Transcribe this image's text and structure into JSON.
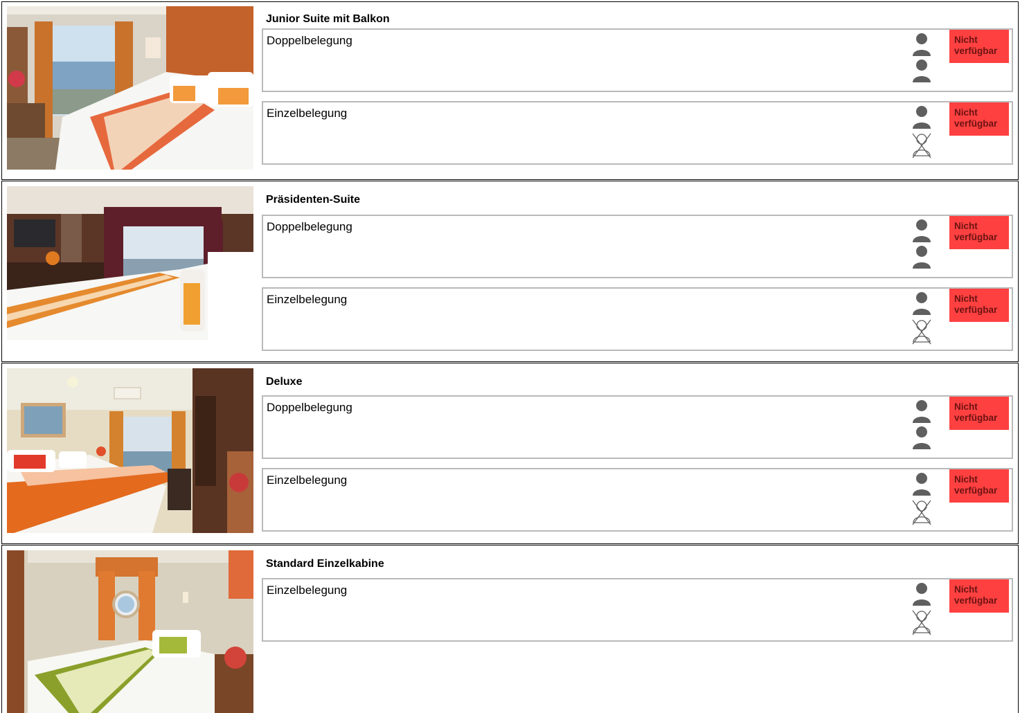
{
  "cabins": [
    {
      "title": "Junior Suite mit Balkon",
      "options": [
        {
          "label": "Doppelbelegung",
          "persons": 2,
          "status": "Nicht verfügbar"
        },
        {
          "label": "Einzelbelegung",
          "persons": 1,
          "status": "Nicht verfügbar"
        }
      ]
    },
    {
      "title": "Präsidenten-Suite",
      "options": [
        {
          "label": "Doppelbelegung",
          "persons": 2,
          "status": "Nicht verfügbar"
        },
        {
          "label": "Einzelbelegung",
          "persons": 1,
          "status": "Nicht verfügbar"
        }
      ]
    },
    {
      "title": "Deluxe",
      "options": [
        {
          "label": "Doppelbelegung",
          "persons": 2,
          "status": "Nicht verfügbar"
        },
        {
          "label": "Einzelbelegung",
          "persons": 1,
          "status": "Nicht verfügbar"
        }
      ]
    },
    {
      "title": "Standard Einzelkabine",
      "options": [
        {
          "label": "Einzelbelegung",
          "persons": 1,
          "status": "Nicht verfügbar"
        }
      ]
    }
  ],
  "icons": {
    "person": "person-icon",
    "no_person": "person-crossed-icon",
    "photo": "cabin-photo"
  },
  "colors": {
    "status_bg": "#ff4040",
    "status_text": "#6b1313",
    "person": "#5f5f5f",
    "option_border": "#b9b9b9"
  }
}
